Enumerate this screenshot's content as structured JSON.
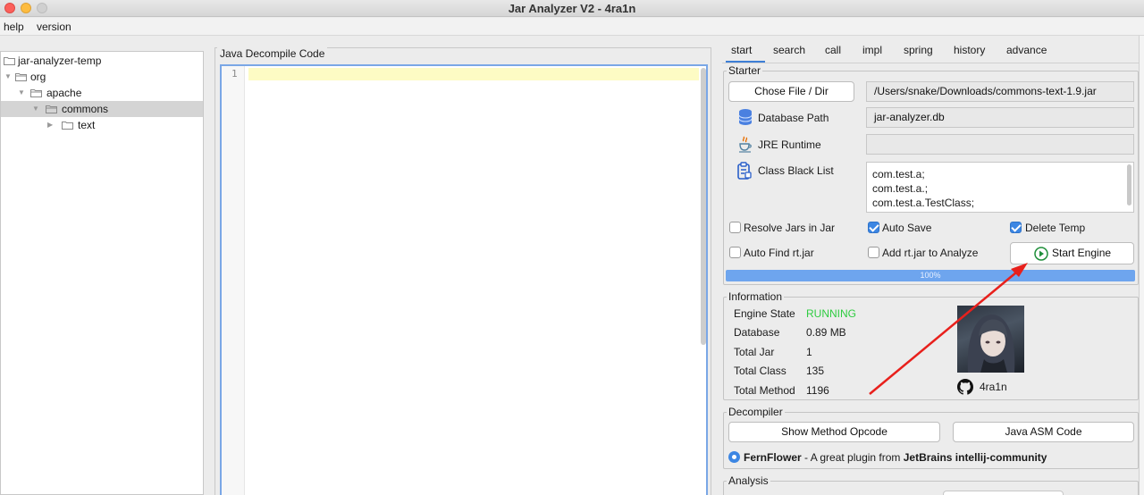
{
  "window": {
    "title": "Jar Analyzer V2 - 4ra1n"
  },
  "menu": {
    "help": "help",
    "version": "version"
  },
  "tree": {
    "root": "jar-analyzer-temp",
    "org": "org",
    "apache": "apache",
    "commons": "commons",
    "text": "text"
  },
  "code": {
    "group_title": "Java Decompile Code",
    "line_number": "1"
  },
  "tabs": [
    "start",
    "search",
    "call",
    "impl",
    "spring",
    "history",
    "advance"
  ],
  "starter": {
    "legend": "Starter",
    "choose_button": "Chose File / Dir",
    "file_path": "/Users/snake/Downloads/commons-text-1.9.jar",
    "db_label": "Database Path",
    "db_value": "jar-analyzer.db",
    "jre_label": "JRE Runtime",
    "jre_value": "",
    "blacklist_label": "Class Black List",
    "blacklist_lines": [
      "com.test.a;",
      "com.test.a.;",
      "com.test.a.TestClass;"
    ],
    "resolve_jars": "Resolve Jars in Jar",
    "auto_save": "Auto Save",
    "delete_temp": "Delete Temp",
    "auto_find_rt": "Auto Find rt.jar",
    "add_rt": "Add rt.jar to Analyze",
    "start_engine": "Start Engine",
    "progress_text": "100%",
    "progress_value": 100,
    "checks": {
      "resolve_jars": false,
      "auto_save": true,
      "delete_temp": true,
      "auto_find_rt": false,
      "add_rt": false
    }
  },
  "information": {
    "legend": "Information",
    "engine_state_label": "Engine State",
    "engine_state_value": "RUNNING",
    "database_label": "Database",
    "database_value": "0.89 MB",
    "total_jar_label": "Total Jar",
    "total_jar_value": "1",
    "total_class_label": "Total Class",
    "total_class_value": "135",
    "total_method_label": "Total Method",
    "total_method_value": "1196",
    "author": "4ra1n"
  },
  "decompiler": {
    "legend": "Decompiler",
    "opcode_button": "Show Method Opcode",
    "asm_button": "Java ASM Code",
    "option_name": "FernFlower",
    "option_mid": " - A great plugin from ",
    "option_brand": "JetBrains intellij-community"
  },
  "analysis": {
    "legend": "Analysis"
  },
  "colors": {
    "accent": "#3c86e3",
    "running": "#2ecc40",
    "annotation_arrow": "#e8201c",
    "highlight_line": "#fdfbc4"
  }
}
